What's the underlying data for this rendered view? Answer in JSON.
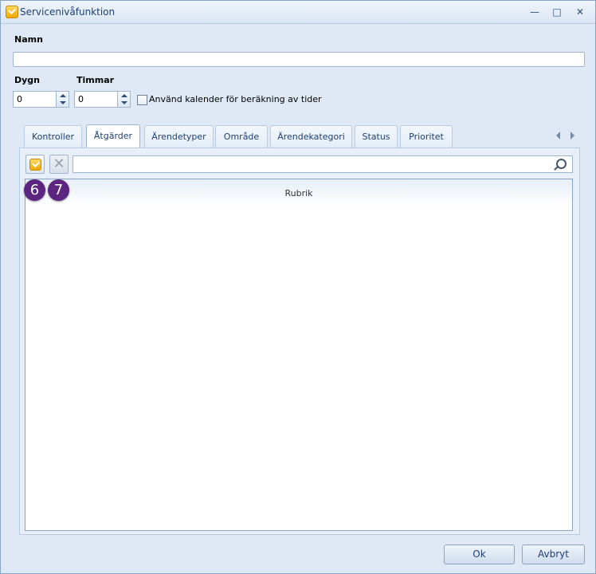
{
  "window": {
    "title": "Servicenivåfunktion"
  },
  "form": {
    "name_label": "Namn",
    "name_value": "",
    "dygn_label": "Dygn",
    "dygn_value": "0",
    "timmar_label": "Timmar",
    "timmar_value": "0",
    "calendar_label": "Använd kalender för beräkning av tider"
  },
  "tabs": [
    {
      "label": "Kontroller"
    },
    {
      "label": "Åtgärder",
      "active": true
    },
    {
      "label": "Ärendetyper"
    },
    {
      "label": "Område"
    },
    {
      "label": "Ärendekategori"
    },
    {
      "label": "Status"
    },
    {
      "label": "Prioritet"
    }
  ],
  "grid": {
    "search_value": "",
    "columns": [
      {
        "label": "Rubrik"
      }
    ]
  },
  "annotations": {
    "badge_add": "6",
    "badge_delete": "7"
  },
  "buttons": {
    "ok_label": "Ok",
    "cancel_label": "Avbryt"
  },
  "colors": {
    "accent": "#1e3f73",
    "badge": "#5b2580",
    "window_bg": "#dfe9f5"
  }
}
